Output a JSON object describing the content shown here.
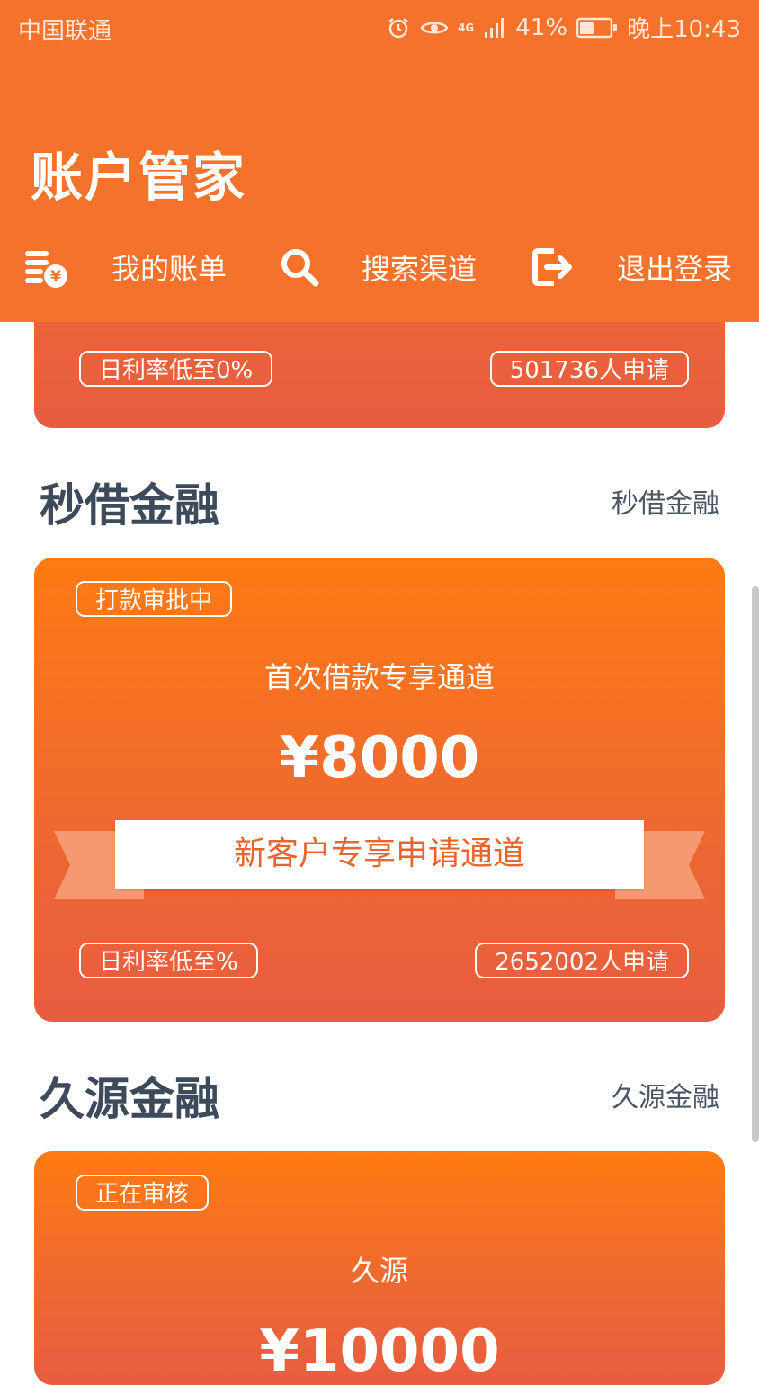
{
  "status_bar": {
    "carrier": "中国联通",
    "network": "4G",
    "battery": "41%",
    "time": "晚上10:43"
  },
  "header": {
    "title": "账户管家",
    "nav": [
      {
        "icon": "bill-icon",
        "label": "我的账单"
      },
      {
        "icon": "search-icon",
        "label": "搜索渠道"
      },
      {
        "icon": "logout-icon",
        "label": "退出登录"
      }
    ]
  },
  "cards": [
    {
      "rate": "日利率低至0%",
      "applicants": "501736人申请"
    },
    {
      "section_title": "秒借金融",
      "section_link": "秒借金融",
      "status": "打款审批中",
      "subtitle": "首次借款专享通道",
      "amount": "¥8000",
      "ribbon": "新客户专享申请通道",
      "rate": "日利率低至%",
      "applicants": "2652002人申请"
    },
    {
      "section_title": "久源金融",
      "section_link": "久源金融",
      "status": "正在审核",
      "subtitle": "久源",
      "amount": "¥10000"
    }
  ],
  "colors": {
    "brand": "#f4722b",
    "card_top": "#ff7a12",
    "card_bottom": "#e85c40",
    "title_text": "#3c4a5c"
  }
}
